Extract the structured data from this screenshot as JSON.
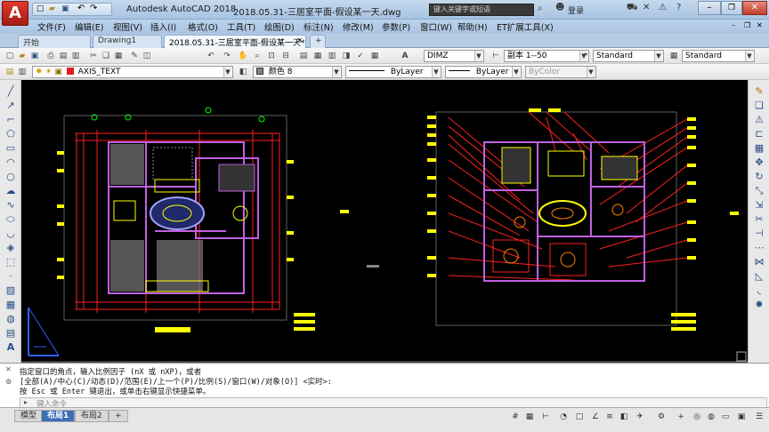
{
  "app": {
    "title": "Autodesk AutoCAD 2018",
    "filename": "2018.05.31-三居室平面-假设某一天.dwg",
    "logo_letter": "A",
    "search_placeholder": "键入关键字或短语",
    "login_label": "登录"
  },
  "menu": {
    "items": [
      "文件(F)",
      "编辑(E)",
      "视图(V)",
      "插入(I)",
      "格式(O)",
      "工具(T)",
      "绘图(D)",
      "标注(N)",
      "修改(M)",
      "参数(P)",
      "窗口(W)",
      "帮助(H)",
      "ET扩展工具(X)"
    ]
  },
  "doc_tabs": {
    "tabs": [
      "开始",
      "Drawing1",
      "2018.05.31-三居室平面-假设某一天*"
    ],
    "add_label": "+"
  },
  "toolbar1": {
    "dimstyle": "DIMZ",
    "scale": "副本 1--50",
    "textstyle": "Standard",
    "tablestyle": "Standard"
  },
  "toolbar2": {
    "layer": "AXIS_TEXT",
    "color": "颜色 8",
    "linetype": "ByLayer",
    "lineweight": "ByLayer",
    "plotstyle": "ByColor"
  },
  "command": {
    "line1": "指定窗口的角点，输入比例因子 (nX 或 nXP)，或者",
    "line2": "[全部(A)/中心(C)/动态(D)/范围(E)/上一个(P)/比例(S)/窗口(W)/对象(O)] <实时>:",
    "line3": "按 Esc 或 Enter 键退出，或单击右键显示快捷菜单。",
    "input_placeholder": "键入命令"
  },
  "layout_tabs": {
    "tabs": [
      "模型",
      "布局1",
      "布局2"
    ],
    "active": "布局1",
    "add_label": "+"
  },
  "colors": {
    "canvas_bg": "#000000",
    "wall": "#c060e0",
    "dimension": "#ff2020",
    "annotation": "#ffff00",
    "hatch": "#b0b0b0",
    "axis_bubble": "#00ff00",
    "ucs": "#3060ff"
  },
  "icons": [
    "autocad-logo-icon",
    "search-icon",
    "user-icon",
    "cart-icon",
    "exchange-icon",
    "help-icon",
    "minimize-icon",
    "maximize-icon",
    "close-icon"
  ]
}
